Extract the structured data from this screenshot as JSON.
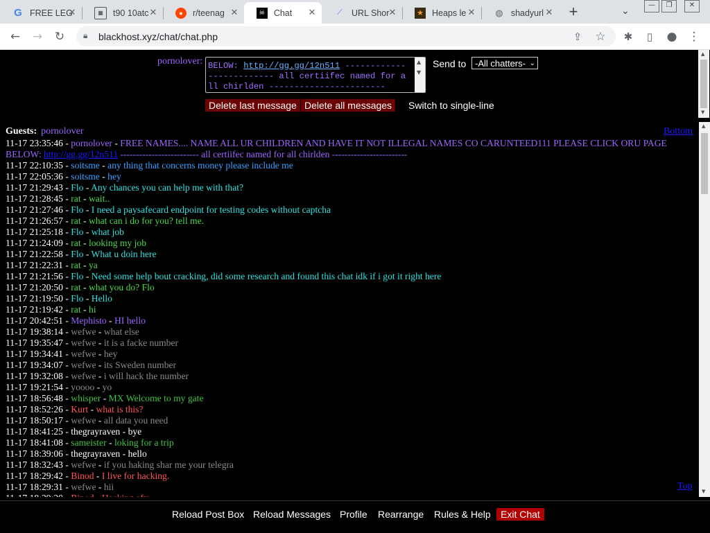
{
  "browser": {
    "tabs": [
      {
        "title": "FREE LEG",
        "icon": "google-icon"
      },
      {
        "title": "t90 10atc",
        "icon": "site-icon"
      },
      {
        "title": "r/teenag",
        "icon": "reddit-icon"
      },
      {
        "title": "Chat",
        "icon": "pirate-icon"
      },
      {
        "title": "URL Shor",
        "icon": "link-icon"
      },
      {
        "title": "Heaps le",
        "icon": "star-icon"
      },
      {
        "title": "shadyurl",
        "icon": "globe-icon"
      }
    ],
    "active_tab": 3,
    "url": "blackhost.xyz/chat/chat.php"
  },
  "post": {
    "nickname": "pornolover",
    "message_link": "http://gg.gg/12n511",
    "message_before": "BELOW: ",
    "message_after": " ------------------------- all certiifec named for all chirlden -----------------------",
    "send_to_label": "Send to",
    "send_to_value": "-All chatters-",
    "delete_last": "Delete last message",
    "delete_all": "Delete all messages",
    "switch_single": "Switch to single-line"
  },
  "chat": {
    "guests_label": "Guests:",
    "guest_name": "pornolover",
    "bottom_link": "Bottom",
    "top_link": "Top",
    "colors": {
      "purple": "#9a66ff",
      "blue": "#3aa0ff",
      "cyan": "#2fe0e0",
      "green": "#4cd84c",
      "gray": "#8a8a8a",
      "red": "#ff5555",
      "white": "#ffffff",
      "yellowgreen": "#40c040"
    },
    "messages": [
      {
        "ts": "11-17 23:35:46",
        "nick": "pornolover",
        "text": "FREE NAMES.... NAME ALL UR CHILDREN AND HAVE IT NOT ILLEGAL NAMES CO CARUNTEED111 PLEASE CLICK ORU PAGE BELOW:",
        "link": "http://gg.gg/12n511",
        "tail": " ------------------------- all certiifec named for all chirlden ------------------------",
        "color": "purple"
      },
      {
        "ts": "11-17 22:10:35",
        "nick": "soitsme",
        "text": "any thing that concerns money please include me",
        "color": "blue"
      },
      {
        "ts": "11-17 22:05:36",
        "nick": "soitsme",
        "text": "hey",
        "color": "blue"
      },
      {
        "ts": "11-17 21:29:43",
        "nick": "Flo",
        "text": "Any chances you can help me with that?",
        "color": "cyan"
      },
      {
        "ts": "11-17 21:28:45",
        "nick": "rat",
        "text": "wait..",
        "color": "green"
      },
      {
        "ts": "11-17 21:27:46",
        "nick": "Flo",
        "text": "I need a paysafecard endpoint for testing codes without captcha",
        "color": "cyan"
      },
      {
        "ts": "11-17 21:26:57",
        "nick": "rat",
        "text": "what can i do for you? tell me.",
        "color": "green"
      },
      {
        "ts": "11-17 21:25:18",
        "nick": "Flo",
        "text": "what job",
        "color": "cyan"
      },
      {
        "ts": "11-17 21:24:09",
        "nick": "rat",
        "text": "looking my job",
        "color": "green"
      },
      {
        "ts": "11-17 21:22:58",
        "nick": "Flo",
        "text": "What u doin here",
        "color": "cyan"
      },
      {
        "ts": "11-17 21:22:31",
        "nick": "rat",
        "text": "ya",
        "color": "green"
      },
      {
        "ts": "11-17 21:21:56",
        "nick": "Flo",
        "text": "Need some help bout cracking, did some research and found this chat idk if i got it right here",
        "color": "cyan"
      },
      {
        "ts": "11-17 21:20:50",
        "nick": "rat",
        "text": "what you do? Flo",
        "color": "green"
      },
      {
        "ts": "11-17 21:19:50",
        "nick": "Flo",
        "text": "Hello",
        "color": "cyan"
      },
      {
        "ts": "11-17 21:19:42",
        "nick": "rat",
        "text": "hi",
        "color": "green"
      },
      {
        "ts": "11-17 20:42:51",
        "nick": "Mephisto",
        "text": "HI hello",
        "color": "purple"
      },
      {
        "ts": "11-17 19:38:14",
        "nick": "wefwe",
        "text": "what else",
        "color": "gray"
      },
      {
        "ts": "11-17 19:35:47",
        "nick": "wefwe",
        "text": "it is a facke number",
        "color": "gray"
      },
      {
        "ts": "11-17 19:34:41",
        "nick": "wefwe",
        "text": "hey",
        "color": "gray"
      },
      {
        "ts": "11-17 19:34:07",
        "nick": "wefwe",
        "text": "its Sweden number",
        "color": "gray"
      },
      {
        "ts": "11-17 19:32:08",
        "nick": "wefwe",
        "text": "i will hack the number",
        "color": "gray"
      },
      {
        "ts": "11-17 19:21:54",
        "nick": "yoooo",
        "text": "yo",
        "color": "gray"
      },
      {
        "ts": "11-17 18:56:48",
        "nick": "whisper",
        "text": "MX Welcome to my gate",
        "color": "yellowgreen"
      },
      {
        "ts": "11-17 18:52:26",
        "nick": "Kurt",
        "text": "what is this?",
        "color": "red"
      },
      {
        "ts": "11-17 18:50:17",
        "nick": "wefwe",
        "text": "all data you need",
        "color": "gray"
      },
      {
        "ts": "11-17 18:41:25",
        "nick": "thegrayraven",
        "text": "bye",
        "color": "white"
      },
      {
        "ts": "11-17 18:41:08",
        "nick": "sameister",
        "text": "loking for a trip",
        "color": "yellowgreen"
      },
      {
        "ts": "11-17 18:39:06",
        "nick": "thegrayraven",
        "text": "hello",
        "color": "white"
      },
      {
        "ts": "11-17 18:32:43",
        "nick": "wefwe",
        "text": "if you haking shar me your telegra",
        "color": "gray"
      },
      {
        "ts": "11-17 18:29:42",
        "nick": "Binod",
        "text": "I live for hacking.",
        "color": "red"
      },
      {
        "ts": "11-17 18:29:31",
        "nick": "wefwe",
        "text": "hii",
        "color": "gray"
      },
      {
        "ts": "11-17 18:29:20",
        "nick": "Binod",
        "text": "Hacking afy",
        "color": "red"
      }
    ]
  },
  "footer": {
    "reload_post": "Reload Post Box",
    "reload_messages": "Reload Messages",
    "profile": "Profile",
    "rearrange": "Rearrange",
    "rules": "Rules & Help",
    "exit": "Exit Chat"
  }
}
